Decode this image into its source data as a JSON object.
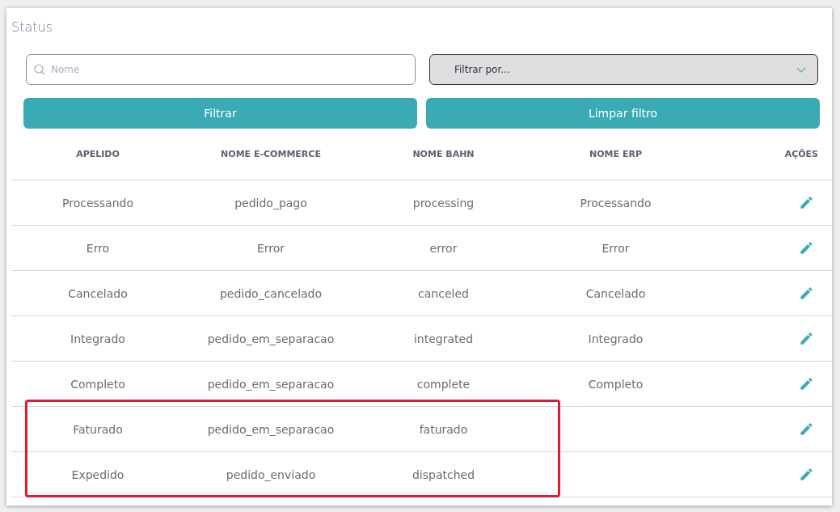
{
  "title": "Status",
  "search": {
    "placeholder": "Nome"
  },
  "filter_select": {
    "placeholder": "Filtrar por..."
  },
  "buttons": [
    "Filtrar",
    "Limpar filtro"
  ],
  "table": {
    "columns": [
      "APELIDO",
      "NOME E-COMMERCE",
      "NOME BAHN",
      "NOME ERP",
      "AÇÕES"
    ],
    "rows": [
      {
        "cells": [
          "Processando",
          "pedido_pago",
          "processing",
          "Processando"
        ],
        "highlighted": false
      },
      {
        "cells": [
          "Erro",
          "Error",
          "error",
          "Error"
        ],
        "highlighted": false
      },
      {
        "cells": [
          "Cancelado",
          "pedido_cancelado",
          "canceled",
          "Cancelado"
        ],
        "highlighted": false
      },
      {
        "cells": [
          "Integrado",
          "pedido_em_separacao",
          "integrated",
          "Integrado"
        ],
        "highlighted": false
      },
      {
        "cells": [
          "Completo",
          "pedido_em_separacao",
          "complete",
          "Completo"
        ],
        "highlighted": false
      },
      {
        "cells": [
          "Faturado",
          "pedido_em_separacao",
          "faturado",
          ""
        ],
        "highlighted": true
      },
      {
        "cells": [
          "Expedido",
          "pedido_enviado",
          "dispatched",
          ""
        ],
        "highlighted": true
      }
    ]
  }
}
